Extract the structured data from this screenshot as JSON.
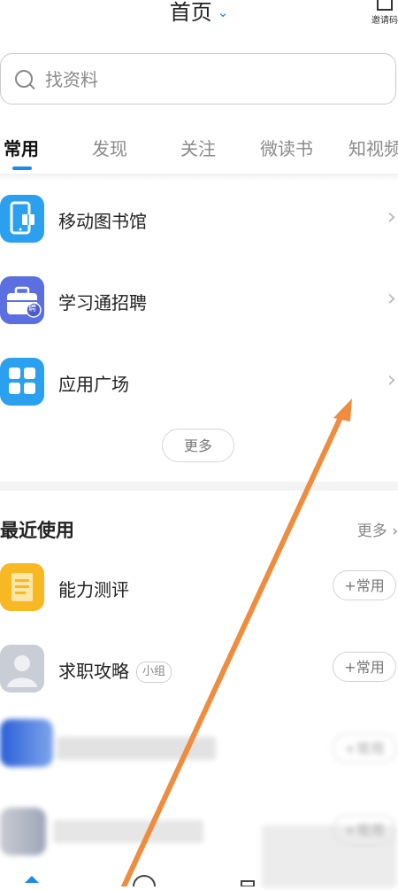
{
  "header": {
    "title": "首页",
    "title_chevron_icon": "chevron-down-icon",
    "invite_label": "邀请码",
    "invite_icon": "qr-scan-icon"
  },
  "search": {
    "placeholder": "找资料",
    "value": ""
  },
  "tabs": [
    {
      "label": "常用",
      "active": true
    },
    {
      "label": "发现",
      "active": false
    },
    {
      "label": "关注",
      "active": false
    },
    {
      "label": "微读书",
      "active": false
    },
    {
      "label": "知视频",
      "active": false
    }
  ],
  "common": {
    "items": [
      {
        "label": "移动图书馆",
        "icon": "mobile-library-icon",
        "color": "#2aa0ef"
      },
      {
        "label": "学习通招聘",
        "icon": "briefcase-icon",
        "badge_text": "聘",
        "color": "#5b6fe0"
      },
      {
        "label": "应用广场",
        "icon": "app-grid-icon",
        "color": "#2aa0ef"
      }
    ],
    "more_label": "更多"
  },
  "recent": {
    "title": "最近使用",
    "more_label": "更多",
    "items": [
      {
        "label": "能力测评",
        "icon": "document-icon",
        "color": "#f7b824",
        "add_label": "+常用"
      },
      {
        "label": "求职攻略",
        "badge": "小组",
        "icon": "avatar-placeholder-icon",
        "color": "#c9ced6",
        "add_label": "+常用"
      },
      {
        "label": "",
        "icon": "blurred-thumbnail-icon",
        "add_label": "+常用"
      },
      {
        "label": "",
        "icon": "blurred-thumbnail-icon",
        "add_label": "+常用"
      }
    ]
  },
  "colors": {
    "accent": "#1e8ae8",
    "annotation_arrow": "#f08c3e"
  }
}
